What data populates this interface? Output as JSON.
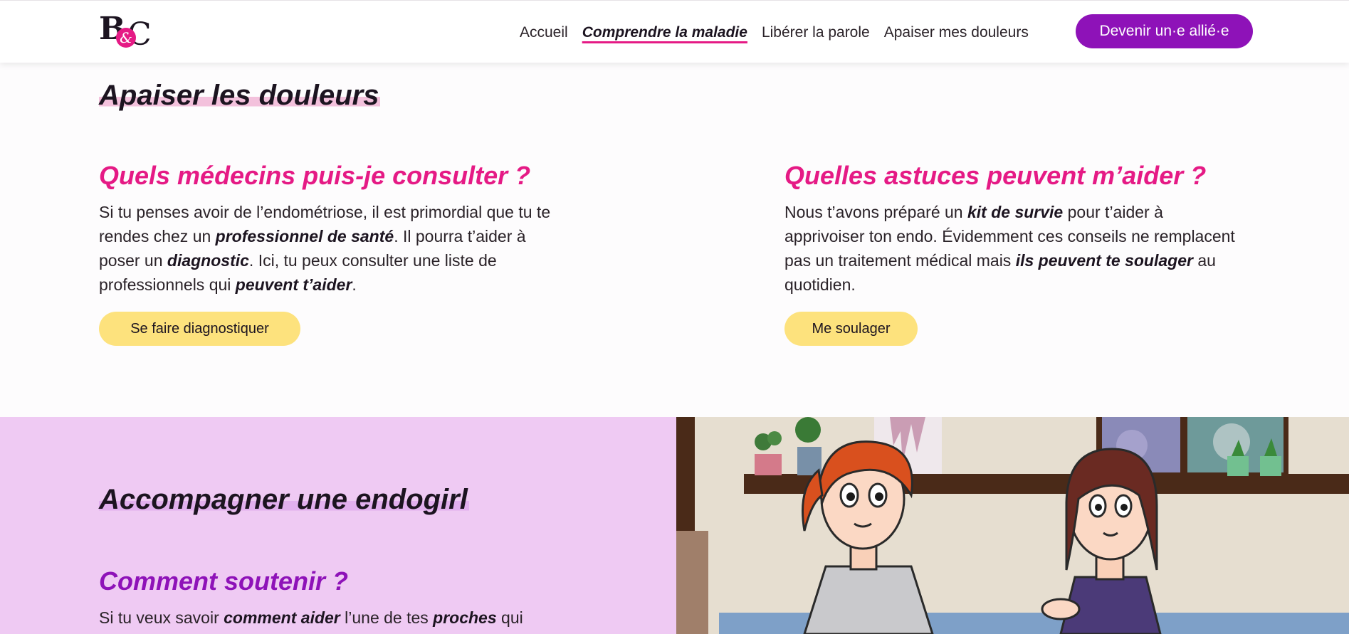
{
  "header": {
    "logo": {
      "letter_b": "B",
      "letter_amp": "&",
      "letter_c": "C"
    },
    "nav": [
      "Accueil",
      "Comprendre la maladie",
      "Libérer la parole",
      "Apaiser mes douleurs"
    ],
    "cta": "Devenir un·e allié·e",
    "colors": {
      "accent": "#e51a85",
      "brand": "#8e12b8"
    }
  },
  "section1": {
    "title": "Apaiser les douleurs",
    "col1": {
      "heading": "Quels médecins puis-je consulter ?",
      "t1": "Si tu penses avoir de l’endométriose, il est primordial que tu te rendes chez un ",
      "b1": "professionnel de santé",
      "t2": ". Il pourra t’aider à poser un ",
      "b2": "diagnostic",
      "t3": ". Ici, tu peux consulter une liste de professionnels qui ",
      "b3": "peuvent t’aider",
      "t4": ".",
      "button": "Se faire diagnostiquer"
    },
    "col2": {
      "heading": "Quelles astuces peuvent m’aider ?",
      "t1": "Nous t’avons préparé un ",
      "b1": "kit de survie",
      "t2": " pour t’aider à apprivoiser ton endo. Évidemment ces conseils ne remplacent pas un traitement médical mais ",
      "b2": "ils peuvent te soulager",
      "t3": " au quotidien.",
      "button": "Me soulager"
    },
    "colors": {
      "pill": "#fde27d",
      "heading": "#e51a85"
    }
  },
  "section2": {
    "title": "Accompagner une endogirl",
    "heading": "Comment soutenir ?",
    "t1": "Si tu veux savoir ",
    "b1": "comment aider",
    "t2": " l’une de tes ",
    "b2": "proches",
    "t3": " qui",
    "colors": {
      "background": "#efcaf3",
      "heading": "#8e12b8"
    }
  }
}
